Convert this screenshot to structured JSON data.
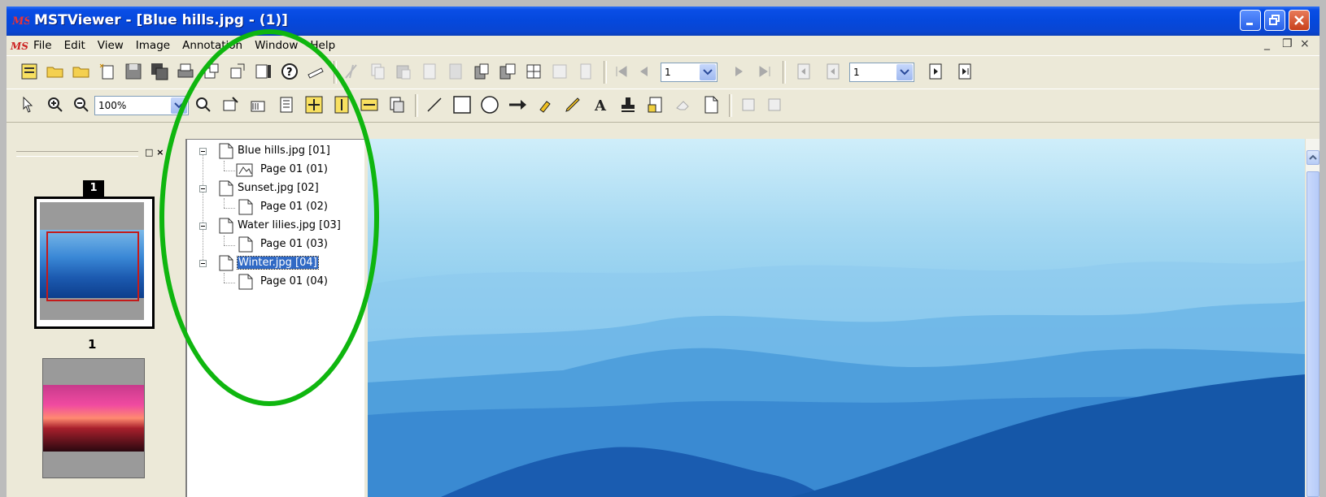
{
  "window": {
    "title": "MSTViewer - [Blue hills.jpg - (1)]"
  },
  "menu": {
    "items": [
      "File",
      "Edit",
      "View",
      "Image",
      "Annotation",
      "Window",
      "Help"
    ],
    "mdi_controls": [
      "_",
      "❐",
      "×"
    ]
  },
  "toolbar1": {
    "page_combo_value": "1",
    "page_combo2_value": "1"
  },
  "toolbar2": {
    "zoom_value": "100%"
  },
  "thumbnails": {
    "panel_buttons": "□ ×",
    "items": [
      {
        "badge": "1",
        "label": "1"
      },
      {
        "badge": "",
        "label": ""
      }
    ]
  },
  "tree": {
    "documents": [
      {
        "name": "Blue hills.jpg [01]",
        "page": "Page 01 (01)"
      },
      {
        "name": "Sunset.jpg [02]",
        "page": "Page 01 (02)"
      },
      {
        "name": "Water lilies.jpg [03]",
        "page": "Page 01 (03)"
      },
      {
        "name": "Winter.jpg [04]",
        "page": "Page 01 (04)"
      }
    ]
  },
  "colors": {
    "title_bar": "#0548dc",
    "highlight_circle": "#0fb60f",
    "selection": "#316ac5"
  }
}
